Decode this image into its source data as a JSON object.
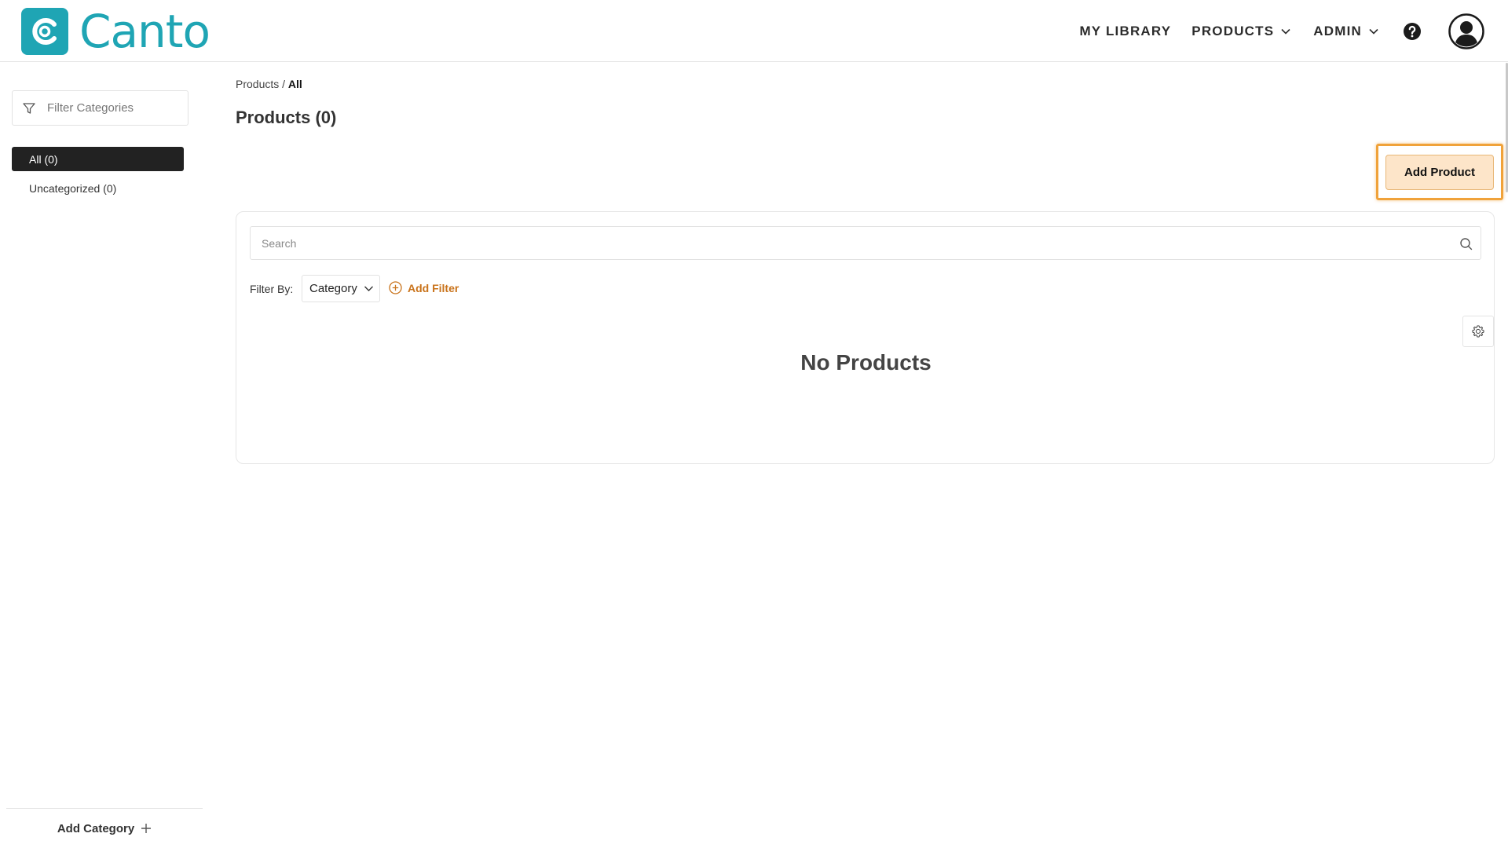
{
  "header": {
    "logo_text": "Canto",
    "nav": {
      "library": "MY LIBRARY",
      "products": "PRODUCTS",
      "admin": "ADMIN"
    },
    "colors": {
      "brand": "#1fa5b4"
    }
  },
  "sidebar": {
    "filter_placeholder": "Filter Categories",
    "categories": [
      {
        "label": "All (0)",
        "active": true
      },
      {
        "label": "Uncategorized (0)",
        "active": false
      }
    ],
    "add_category_label": "Add Category"
  },
  "main": {
    "breadcrumb": {
      "parent": "Products",
      "separator": " / ",
      "current": "All"
    },
    "title": "Products (0)",
    "add_product_label": "Add Product",
    "search_placeholder": "Search",
    "filter_by_label": "Filter By:",
    "category_filter_value": "Category",
    "add_filter_label": "Add Filter",
    "empty_message": "No Products",
    "colors": {
      "accent": "#c9731b",
      "highlight": "#f0a23a",
      "button_bg": "#fde5c9"
    }
  }
}
